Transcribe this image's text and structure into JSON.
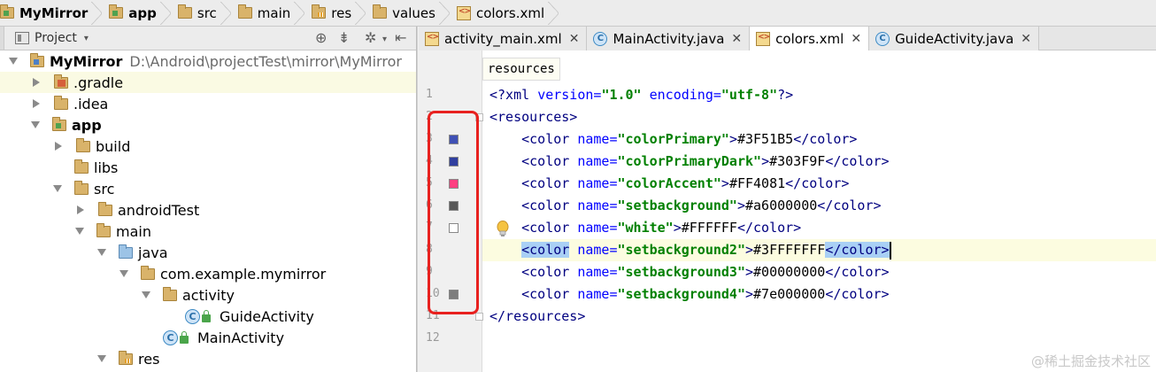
{
  "breadcrumbs": [
    {
      "label": "MyMirror",
      "icon": "module-folder-icon",
      "bold": true
    },
    {
      "label": "app",
      "icon": "module-folder-icon",
      "bold": true
    },
    {
      "label": "src",
      "icon": "folder-icon",
      "bold": false
    },
    {
      "label": "main",
      "icon": "folder-icon",
      "bold": false
    },
    {
      "label": "res",
      "icon": "resource-folder-icon",
      "bold": false
    },
    {
      "label": "values",
      "icon": "folder-icon",
      "bold": false
    },
    {
      "label": "colors.xml",
      "icon": "xml-file-icon",
      "bold": false
    }
  ],
  "project_panel": {
    "title": "Project",
    "tools": [
      "target-icon",
      "collapse-icon",
      "gear-icon",
      "hide-panel-icon"
    ]
  },
  "tree": [
    {
      "label": "MyMirror",
      "path": "D:\\Android\\projectTest\\mirror\\MyMirror",
      "bold": true,
      "icon": "module-project-icon",
      "expander": "expanded",
      "indent": 0,
      "highlight": false
    },
    {
      "label": ".gradle",
      "icon": "excluded-folder-icon",
      "expander": "collapsed",
      "indent": 1,
      "highlight": true
    },
    {
      "label": ".idea",
      "icon": "folder-icon",
      "expander": "collapsed",
      "indent": 1,
      "highlight": false
    },
    {
      "label": "app",
      "bold": true,
      "icon": "module-folder-icon",
      "expander": "expanded",
      "indent": 1,
      "highlight": false
    },
    {
      "label": "build",
      "icon": "folder-icon",
      "expander": "collapsed",
      "indent": 2,
      "highlight": false
    },
    {
      "label": "libs",
      "icon": "folder-icon",
      "expander": "none",
      "indent": 2,
      "highlight": false
    },
    {
      "label": "src",
      "icon": "folder-icon",
      "expander": "expanded",
      "indent": 2,
      "highlight": false
    },
    {
      "label": "androidTest",
      "icon": "folder-icon",
      "expander": "collapsed",
      "indent": 3,
      "highlight": false
    },
    {
      "label": "main",
      "icon": "folder-icon",
      "expander": "expanded",
      "indent": 3,
      "highlight": false
    },
    {
      "label": "java",
      "icon": "source-folder-icon",
      "expander": "expanded",
      "indent": 4,
      "highlight": false
    },
    {
      "label": "com.example.mymirror",
      "icon": "package-icon",
      "expander": "expanded",
      "indent": 5,
      "highlight": false
    },
    {
      "label": "activity",
      "icon": "package-icon",
      "expander": "expanded",
      "indent": 6,
      "highlight": false
    },
    {
      "label": "GuideActivity",
      "icon": "class-icon",
      "expander": "none",
      "indent": 7,
      "highlight": false
    },
    {
      "label": "MainActivity",
      "icon": "class-icon",
      "expander": "none",
      "indent": 6,
      "highlight": false
    },
    {
      "label": "res",
      "icon": "resource-folder-icon",
      "expander": "expanded",
      "indent": 4,
      "highlight": false
    }
  ],
  "tabs": [
    {
      "label": "activity_main.xml",
      "icon": "xml-file-icon",
      "active": false
    },
    {
      "label": "MainActivity.java",
      "icon": "class-icon",
      "active": false
    },
    {
      "label": "colors.xml",
      "icon": "xml-file-icon",
      "active": true
    },
    {
      "label": "GuideActivity.java",
      "icon": "class-icon",
      "active": false
    }
  ],
  "editor": {
    "crumb": "resources",
    "lines": [
      {
        "num": "1",
        "parts": [
          [
            "tag",
            "<?xml "
          ],
          [
            "attr",
            "version="
          ],
          [
            "val",
            "\"1.0\""
          ],
          [
            "attr",
            " encoding="
          ],
          [
            "val",
            "\"utf-8\""
          ],
          [
            "tag",
            "?>"
          ]
        ],
        "swatch": null
      },
      {
        "num": "2",
        "parts": [
          [
            "tag",
            "<resources>"
          ]
        ],
        "swatch": null
      },
      {
        "num": "3",
        "parts": [
          [
            "tag",
            "    <color "
          ],
          [
            "attr",
            "name="
          ],
          [
            "val",
            "\"colorPrimary\""
          ],
          [
            "tag",
            ">"
          ],
          [
            "txt",
            "#3F51B5"
          ],
          [
            "tag",
            "</color>"
          ]
        ],
        "swatch": "#3F51B5"
      },
      {
        "num": "4",
        "parts": [
          [
            "tag",
            "    <color "
          ],
          [
            "attr",
            "name="
          ],
          [
            "val",
            "\"colorPrimaryDark\""
          ],
          [
            "tag",
            ">"
          ],
          [
            "txt",
            "#303F9F"
          ],
          [
            "tag",
            "</color>"
          ]
        ],
        "swatch": "#303F9F"
      },
      {
        "num": "5",
        "parts": [
          [
            "tag",
            "    <color "
          ],
          [
            "attr",
            "name="
          ],
          [
            "val",
            "\"colorAccent\""
          ],
          [
            "tag",
            ">"
          ],
          [
            "txt",
            "#FF4081"
          ],
          [
            "tag",
            "</color>"
          ]
        ],
        "swatch": "#FF4081"
      },
      {
        "num": "6",
        "parts": [
          [
            "tag",
            "    <color "
          ],
          [
            "attr",
            "name="
          ],
          [
            "val",
            "\"setbackground\""
          ],
          [
            "tag",
            ">"
          ],
          [
            "txt",
            "#a6000000"
          ],
          [
            "tag",
            "</color>"
          ]
        ],
        "swatch": "#595959"
      },
      {
        "num": "7",
        "parts": [
          [
            "tag",
            "    <color "
          ],
          [
            "attr",
            "name="
          ],
          [
            "val",
            "\"white\""
          ],
          [
            "tag",
            ">"
          ],
          [
            "txt",
            "#FFFFFF"
          ],
          [
            "tag",
            "</color>"
          ]
        ],
        "swatch": "#FFFFFF"
      },
      {
        "num": "8",
        "parts": [
          [
            "sp",
            "    "
          ],
          [
            "tagsel",
            "<color"
          ],
          [
            "tag",
            " "
          ],
          [
            "attr",
            "name="
          ],
          [
            "val",
            "\"setbackground2\""
          ],
          [
            "tag",
            ">"
          ],
          [
            "txt",
            "#3FFFFFFF"
          ],
          [
            "tagsel",
            "</color>"
          ],
          [
            "caret",
            ""
          ]
        ],
        "swatch": null,
        "current": true
      },
      {
        "num": "9",
        "parts": [
          [
            "tag",
            "    <color "
          ],
          [
            "attr",
            "name="
          ],
          [
            "val",
            "\"setbackground3\""
          ],
          [
            "tag",
            ">"
          ],
          [
            "txt",
            "#00000000"
          ],
          [
            "tag",
            "</color>"
          ]
        ],
        "swatch": null
      },
      {
        "num": "10",
        "parts": [
          [
            "tag",
            "    <color "
          ],
          [
            "attr",
            "name="
          ],
          [
            "val",
            "\"setbackground4\""
          ],
          [
            "tag",
            ">"
          ],
          [
            "txt",
            "#7e000000"
          ],
          [
            "tag",
            "</color>"
          ]
        ],
        "swatch": "#7d7d7d"
      },
      {
        "num": "11",
        "parts": [
          [
            "tag",
            "</resources>"
          ]
        ],
        "swatch": null
      },
      {
        "num": "12",
        "parts": [],
        "swatch": null
      }
    ]
  },
  "watermark": "@稀土掘金技术社区",
  "colors": {
    "annotation_box": "#e8211f",
    "current_line": "#fcfce0",
    "selection": "#a9d0f5"
  }
}
